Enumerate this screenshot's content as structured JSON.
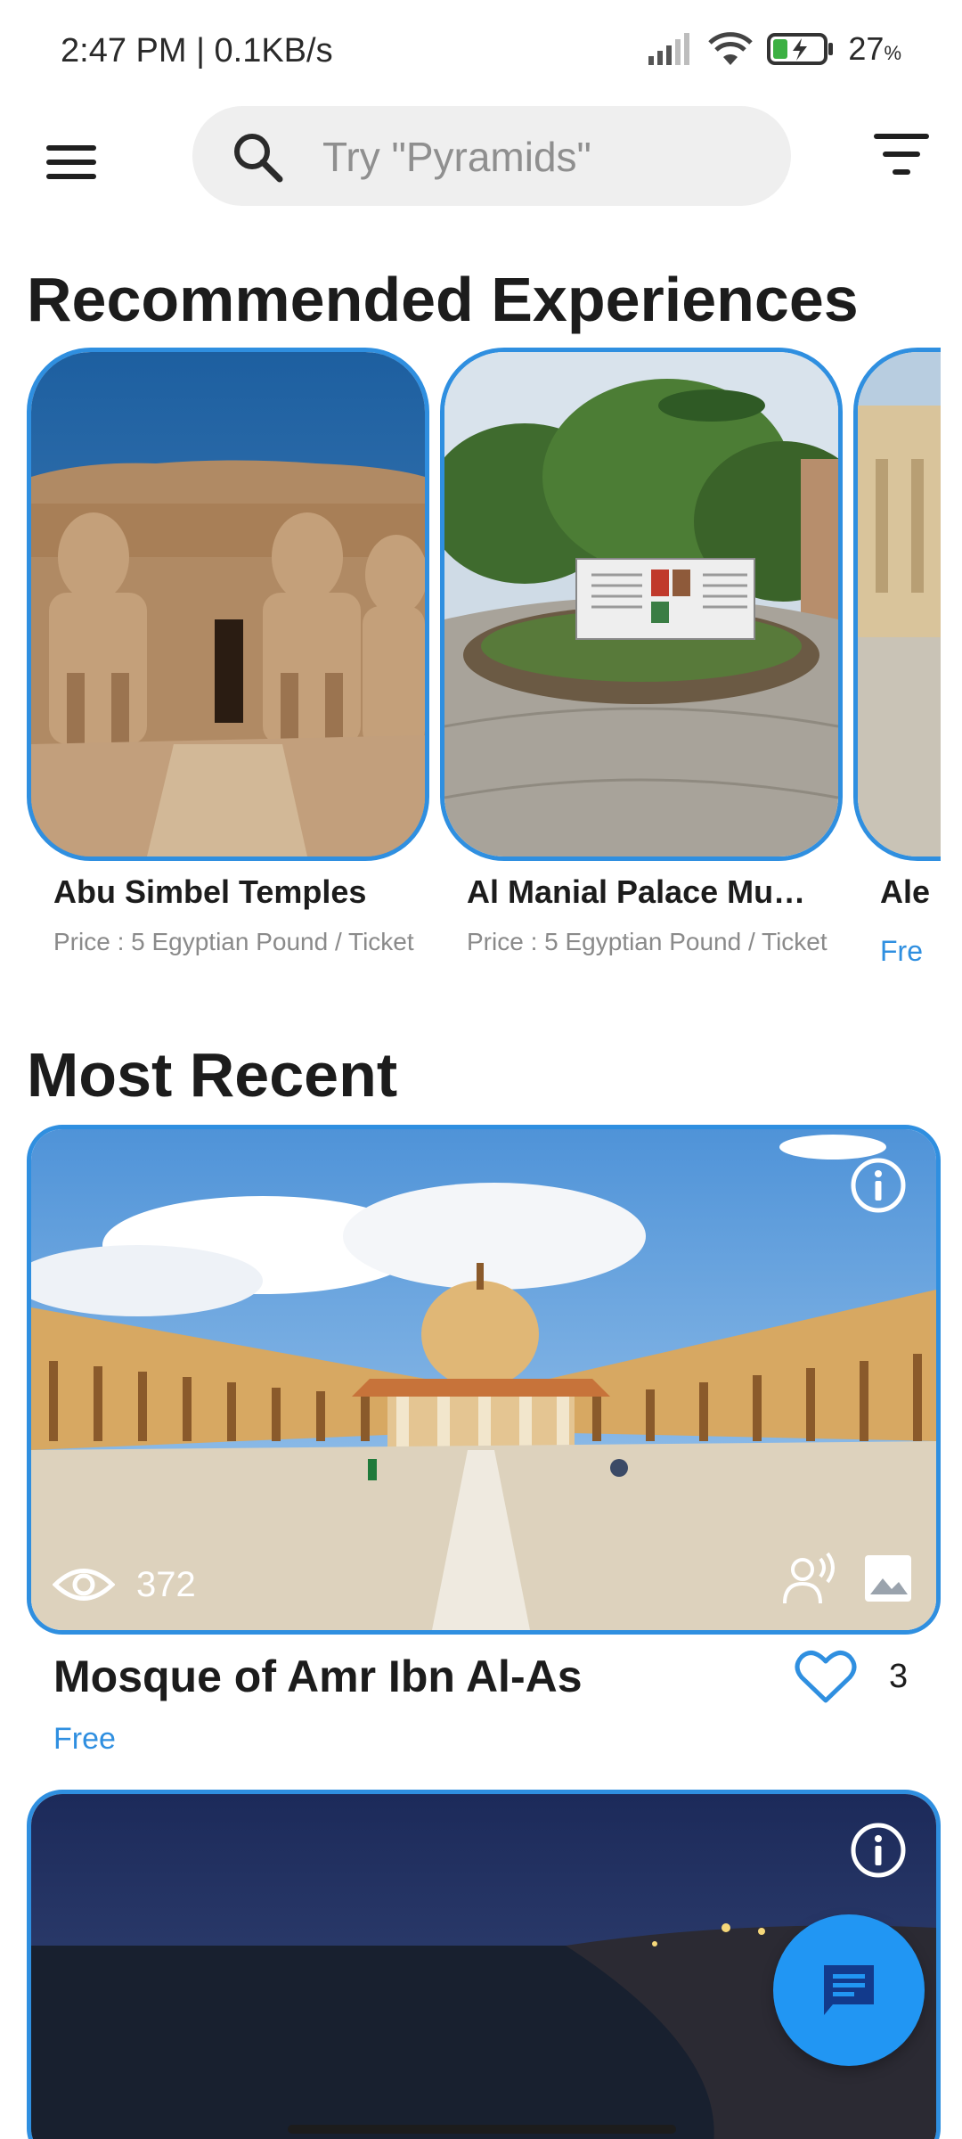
{
  "status_bar": {
    "time": "2:47 PM | 0.1KB/s",
    "battery_percent": "27",
    "battery_unit": "%",
    "icons": [
      "signal-icon",
      "wifi-icon",
      "battery-charging-icon"
    ]
  },
  "app_bar": {
    "menu_icon": "hamburger-menu-icon",
    "search_placeholder": "Try \"Pyramids\"",
    "filter_icon": "filter-icon"
  },
  "recommended": {
    "title": "Recommended Experiences",
    "items": [
      {
        "title": "Abu Simbel Temples",
        "price": "Price : 5 Egyptian Pound / Ticket"
      },
      {
        "title": "Al Manial Palace Mu…",
        "price": "Price : 5 Egyptian Pound / Ticket"
      },
      {
        "title": "Ale",
        "price": "Fre"
      }
    ]
  },
  "most_recent": {
    "title": "Most Recent",
    "items": [
      {
        "title": "Mosque of Amr Ibn Al-As",
        "price": "Free",
        "views": "372",
        "likes": "3"
      }
    ]
  },
  "colors": {
    "accent": "#2f8fe0",
    "fab": "#2196f3",
    "search_bg": "#efefef"
  },
  "fab_icon": "chat-icon"
}
